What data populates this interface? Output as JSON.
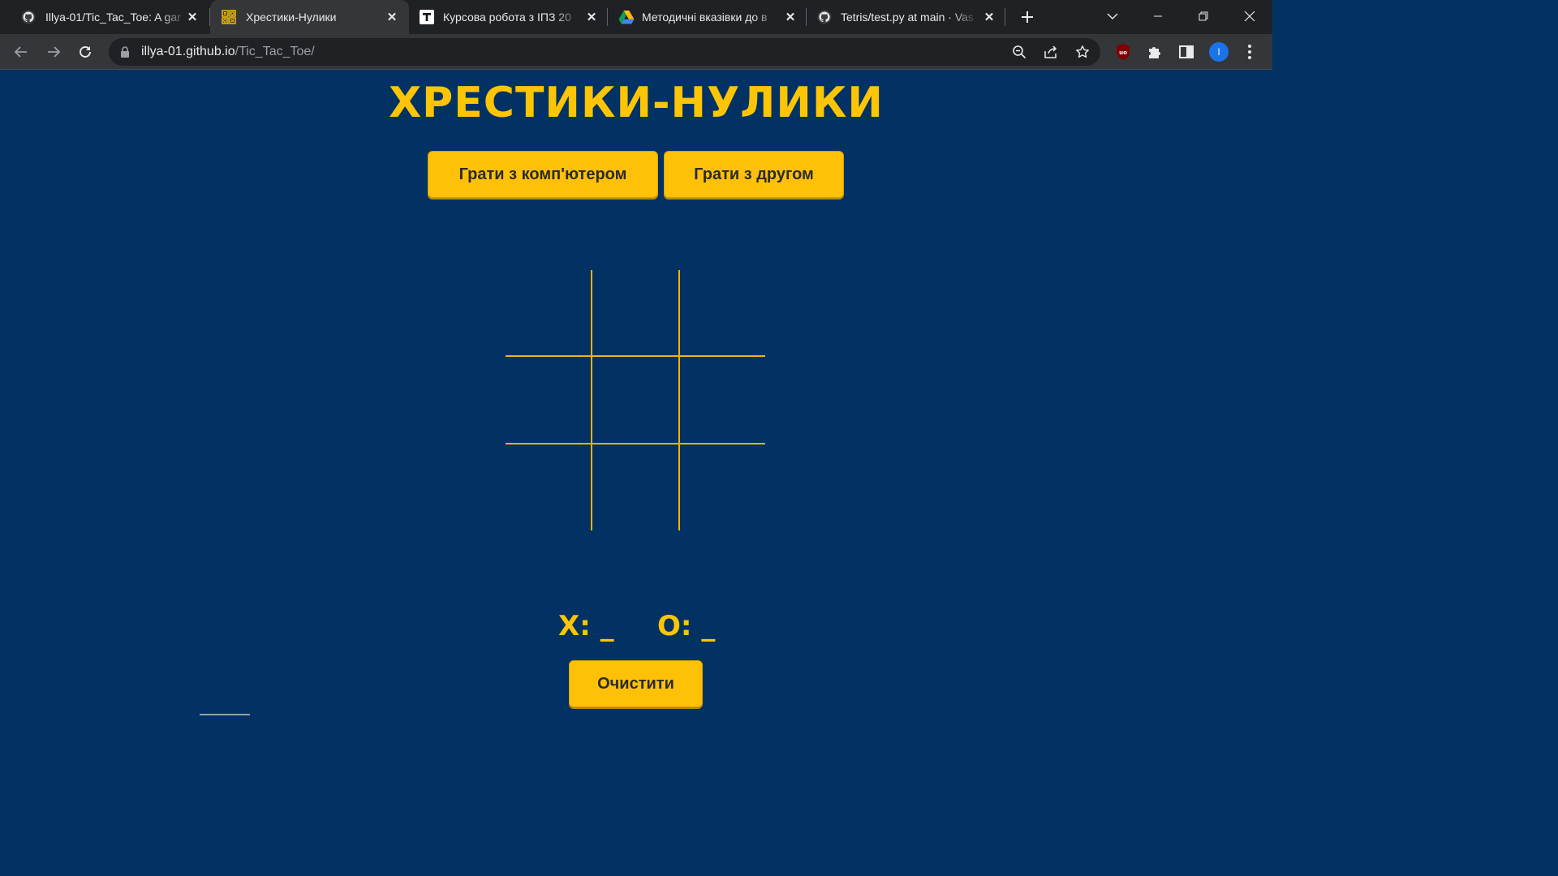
{
  "browser": {
    "tabs": [
      {
        "title": "Illya-01/Tic_Tac_Toe: A gar",
        "favicon": "github-icon",
        "active": false
      },
      {
        "title": "Хрестики-Нулики",
        "favicon": "tictactoe-icon",
        "active": true
      },
      {
        "title": "Курсова робота з ІПЗ 20",
        "favicon": "typora-t-icon",
        "active": false
      },
      {
        "title": "Методичні вказівки до в",
        "favicon": "google-drive-icon",
        "active": false
      },
      {
        "title": "Tetris/test.py at main · Vas",
        "favicon": "github-icon",
        "active": false
      }
    ],
    "url_host": "illya-01.github.io",
    "url_path": "/Tic_Tac_Toe/",
    "profile_initial": "I",
    "colors": {
      "tabstrip": "#202124",
      "toolbar": "#35363a",
      "omnibox": "#202124"
    }
  },
  "page": {
    "title": "ХРЕСТИКИ-НУЛИКИ",
    "buttons": {
      "play_computer": "Грати з комп'ютером",
      "play_friend": "Грати з другом",
      "clear": "Очистити"
    },
    "board": {
      "cells": [
        "",
        "",
        "",
        "",
        "",
        "",
        "",
        "",
        ""
      ]
    },
    "score": {
      "x_label": "X:",
      "x_value": "_",
      "o_label": "O:",
      "o_value": "_"
    },
    "colors": {
      "background": "#013263",
      "accent": "#fdc505",
      "button": "#ffc107",
      "grid": "#f5b301"
    }
  }
}
